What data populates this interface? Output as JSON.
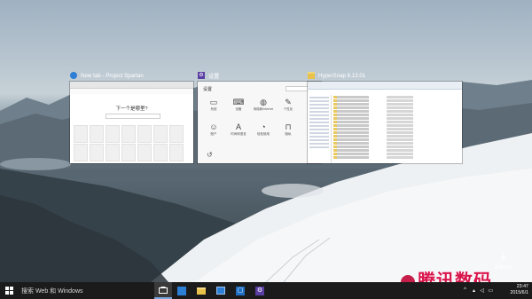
{
  "task_view": {
    "windows": [
      {
        "title": "New tab - Project Spartan",
        "icon": "spartan-icon",
        "content": {
          "heading": "下一个是哪里?"
        }
      },
      {
        "title": "设置",
        "icon": "settings-icon",
        "content": {
          "header": "设置",
          "items": [
            {
              "label": "系统",
              "icon": "laptop-icon"
            },
            {
              "label": "设备",
              "icon": "devices-icon"
            },
            {
              "label": "网络和Internet",
              "icon": "globe-icon"
            },
            {
              "label": "个性化",
              "icon": "brush-icon"
            },
            {
              "label": "账户",
              "icon": "person-icon"
            },
            {
              "label": "时间和语言",
              "icon": "language-icon"
            },
            {
              "label": "轻松使用",
              "icon": "ease-icon"
            },
            {
              "label": "隐私",
              "icon": "lock-icon"
            }
          ]
        }
      },
      {
        "title": "HyperSnap 6.13.01",
        "icon": "folder-icon",
        "content": {}
      }
    ],
    "new_desktop": {
      "label": "新建桌面"
    }
  },
  "watermark": {
    "text": "腾讯数码"
  },
  "taskbar": {
    "search_placeholder": "搜索 Web 和 Windows",
    "apps": [
      {
        "name": "task-view",
        "icon": "task-view-icon"
      },
      {
        "name": "spartan",
        "icon": "spartan-icon"
      },
      {
        "name": "file-explorer",
        "icon": "folder-icon"
      },
      {
        "name": "store",
        "icon": "store-icon"
      },
      {
        "name": "mail",
        "icon": "mail-icon"
      },
      {
        "name": "settings",
        "icon": "settings-icon"
      }
    ],
    "time": "23:47",
    "date": "2015/6/1"
  },
  "colors": {
    "taskbar": "#1b1b1b",
    "accent": "#7aa7e0",
    "settings_icon_bg": "#5b3ea3",
    "watermark": "#d9154b"
  }
}
